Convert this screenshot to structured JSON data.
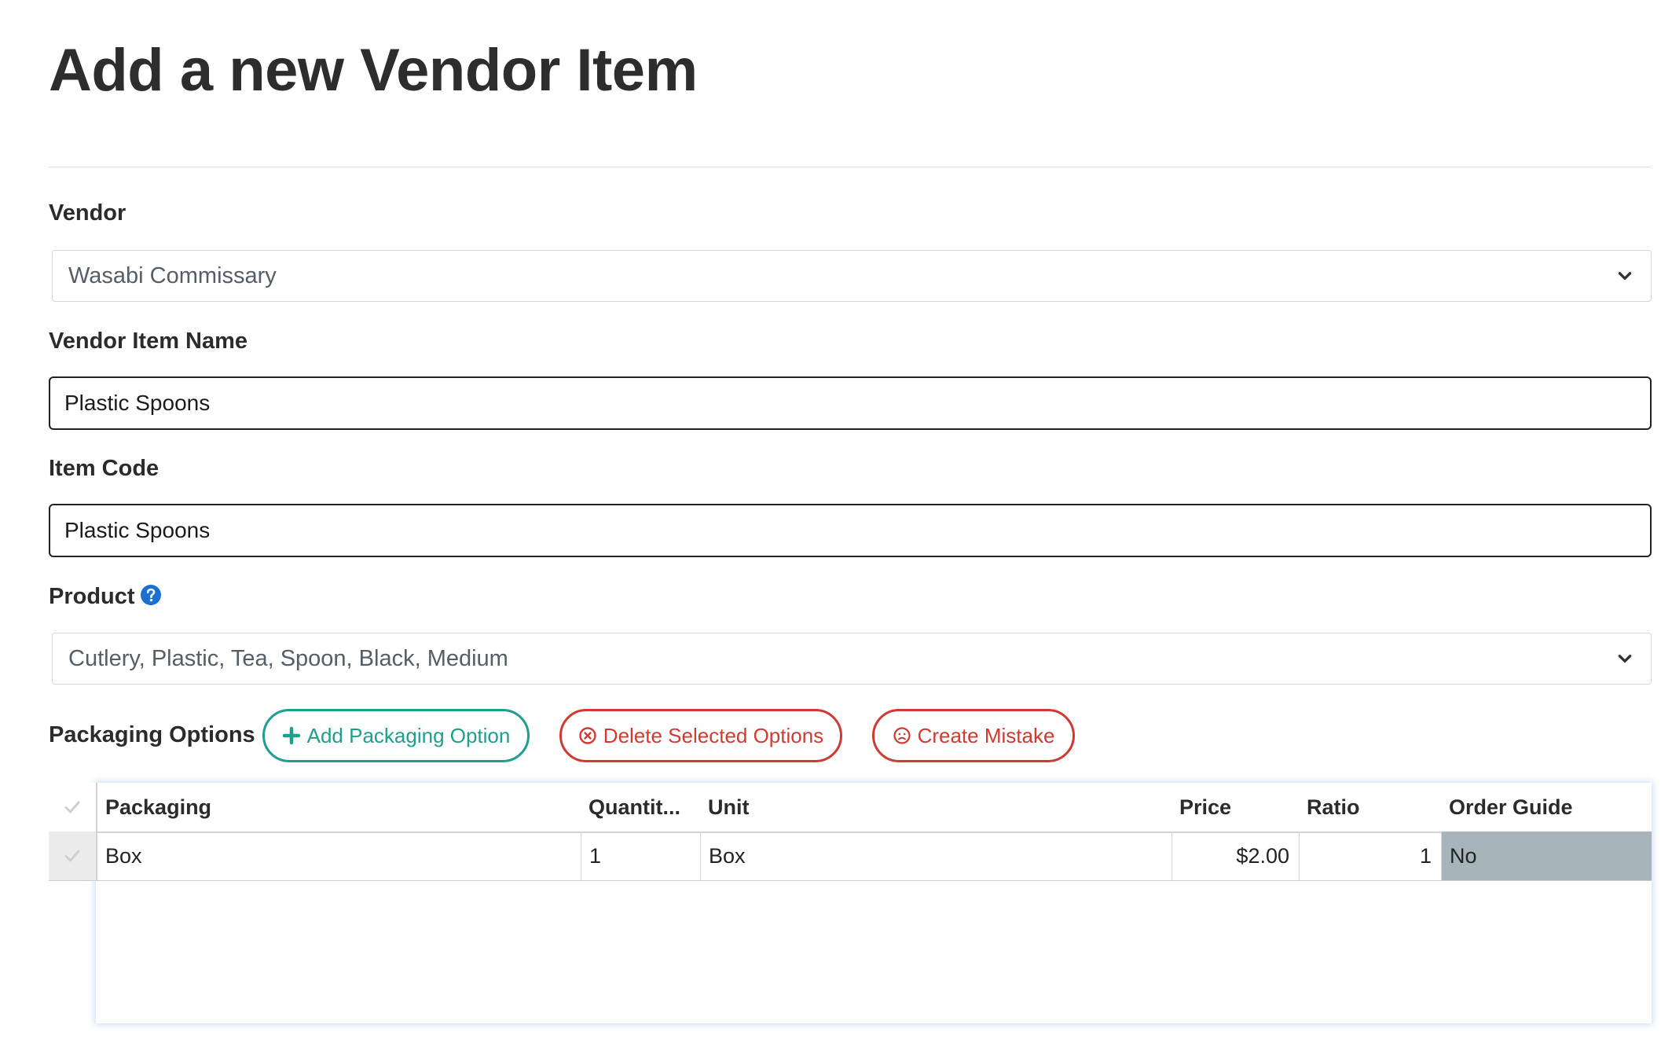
{
  "page": {
    "title": "Add a new Vendor Item"
  },
  "form": {
    "vendor": {
      "label": "Vendor",
      "selected": "Wasabi Commissary"
    },
    "vendor_item_name": {
      "label": "Vendor Item Name",
      "value": "Plastic Spoons"
    },
    "item_code": {
      "label": "Item Code",
      "value": "Plastic Spoons"
    },
    "product": {
      "label": "Product",
      "selected": "Cutlery, Plastic, Tea, Spoon, Black, Medium",
      "help_icon": "question-circle-icon"
    }
  },
  "packaging": {
    "label": "Packaging Options",
    "buttons": {
      "add": "Add Packaging Option",
      "delete": "Delete Selected Options",
      "mistake": "Create Mistake"
    },
    "columns": {
      "packaging": "Packaging",
      "quantity": "Quantit...",
      "unit": "Unit",
      "price": "Price",
      "ratio": "Ratio",
      "order_guide": "Order Guide"
    },
    "rows": [
      {
        "packaging": "Box",
        "quantity": "1",
        "unit": "Box",
        "price": "$2.00",
        "ratio": "1",
        "order_guide": "No"
      }
    ]
  },
  "colors": {
    "teal_accent": "#1f9e8e",
    "red_accent": "#cf3a32",
    "help_blue": "#1d6fd1",
    "order_guide_cell": "#a7b4b9"
  }
}
